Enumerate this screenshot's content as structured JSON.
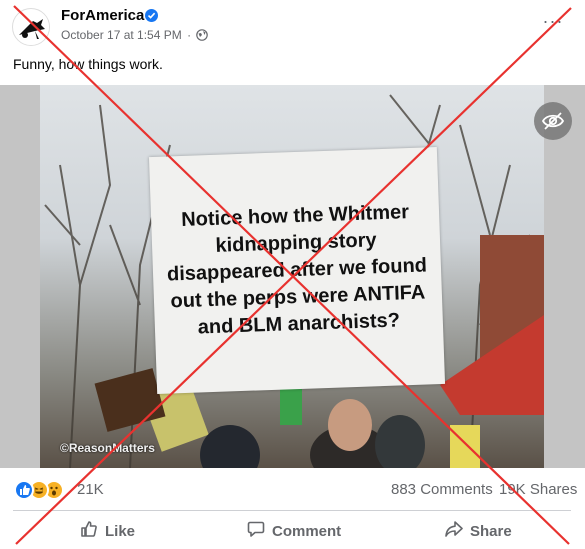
{
  "post": {
    "page_name": "ForAmerica",
    "timestamp": "October 17 at 1:54 PM",
    "separator": "·",
    "audience_icon": "globe-icon",
    "more_label": "···",
    "text": "Funny, how things work."
  },
  "media": {
    "sign_text": "Notice how the Whitmer kidnapping story disappeared after we found out the perps were ANTIFA and BLM anarchists?",
    "watermark": "©ReasonMatters",
    "hide_icon": "eye-slash-icon"
  },
  "stats": {
    "reactions": [
      "like",
      "haha",
      "wow"
    ],
    "reaction_count": "21K",
    "comments": "883 Comments",
    "shares": "19K Shares"
  },
  "actions": {
    "like": "Like",
    "comment": "Comment",
    "share": "Share"
  },
  "overlay": {
    "mark": "red-x",
    "color": "#e8322f"
  },
  "colors": {
    "verified": "#1877f2",
    "secondary_text": "#65676b",
    "divider": "#ced0d4"
  }
}
